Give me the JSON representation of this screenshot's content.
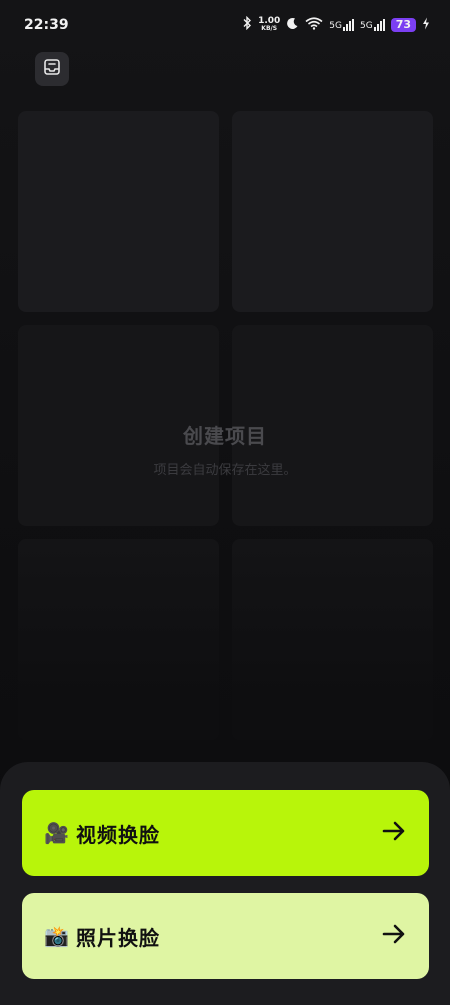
{
  "status_bar": {
    "time": "22:39",
    "speed_value": "1.00",
    "speed_unit": "KB/S",
    "signal1_label": "5G",
    "signal2_label": "5G",
    "battery": "73"
  },
  "empty_state": {
    "title": "创建项目",
    "subtitle": "项目会自动保存在这里。"
  },
  "actions": {
    "video_emoji": "🎥",
    "video_label": "视频换脸",
    "photo_emoji": "📸",
    "photo_label": "照片换脸"
  },
  "colors": {
    "video_button": "#b8f50a",
    "photo_button": "#dff5a3",
    "battery": "#7b3ff2"
  }
}
